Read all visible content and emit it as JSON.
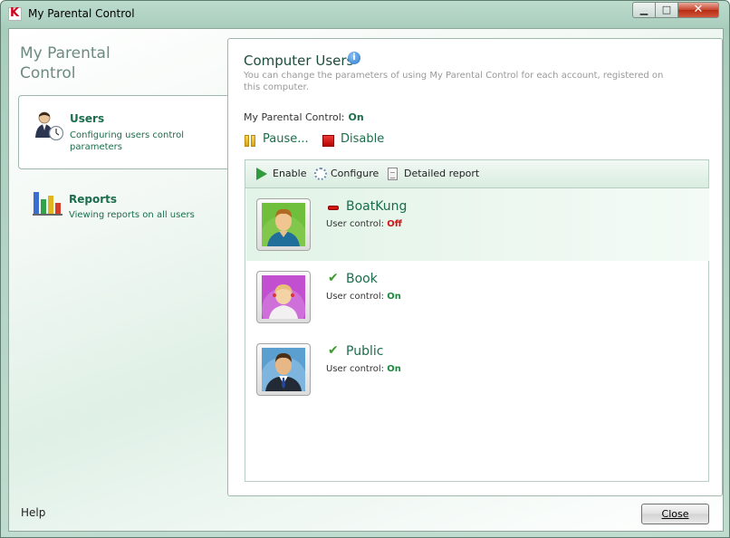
{
  "window": {
    "title": "My Parental Control",
    "controls": {
      "minimize": "▁",
      "maximize": "□",
      "close": "✕"
    }
  },
  "sidebar": {
    "title_line1": "My Parental",
    "title_line2": "Control",
    "items": [
      {
        "label": "Users",
        "description": "Configuring users control parameters",
        "icon": "user-clock-icon",
        "selected": true
      },
      {
        "label": "Reports",
        "description": "Viewing reports on all users",
        "icon": "bar-chart-icon",
        "selected": false
      }
    ],
    "help_label": "Help"
  },
  "main": {
    "title": "Computer Users",
    "subtitle": "You can change the parameters of using My Parental Control for each account, registered on this computer.",
    "status_label": "My Parental Control:",
    "status_value": "On",
    "actions": {
      "pause": "Pause...",
      "disable": "Disable"
    },
    "toolbar": {
      "enable": "Enable",
      "configure": "Configure",
      "report": "Detailed report"
    },
    "user_control_label": "User control:",
    "users": [
      {
        "name": "BoatKung",
        "control": "Off",
        "status_icon": "minus-icon",
        "avatar": "boy-avatar",
        "selected": true
      },
      {
        "name": "Book",
        "control": "On",
        "status_icon": "check-icon",
        "avatar": "girl-avatar",
        "selected": false
      },
      {
        "name": "Public",
        "control": "On",
        "status_icon": "check-icon",
        "avatar": "businessman-avatar",
        "selected": false
      }
    ]
  },
  "footer": {
    "close_label": "Close"
  },
  "colors": {
    "accent": "#1b6d4c",
    "on": "#1b8a3c",
    "off": "#d21414"
  }
}
